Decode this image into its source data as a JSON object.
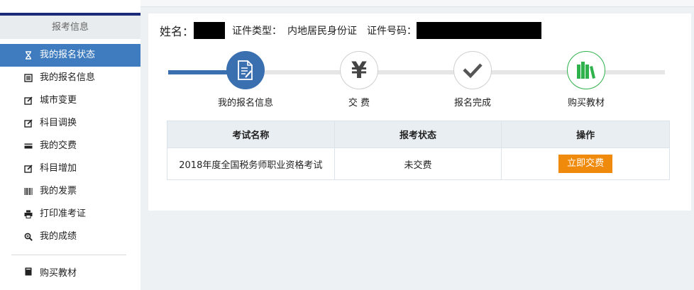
{
  "sidebar": {
    "header": "报考信息",
    "items": [
      {
        "label": "我的报名状态",
        "icon": "hourglass-icon",
        "active": true
      },
      {
        "label": "我的报名信息",
        "icon": "list-icon",
        "active": false
      },
      {
        "label": "城市变更",
        "icon": "edit-icon",
        "active": false
      },
      {
        "label": "科目调换",
        "icon": "edit-icon",
        "active": false
      },
      {
        "label": "我的交费",
        "icon": "credit-card-icon",
        "active": false
      },
      {
        "label": "科目增加",
        "icon": "edit-icon",
        "active": false
      },
      {
        "label": "我的发票",
        "icon": "barcode-icon",
        "active": false
      },
      {
        "label": "打印准考证",
        "icon": "printer-icon",
        "active": false
      },
      {
        "label": "我的成绩",
        "icon": "zoom-icon",
        "active": false
      }
    ],
    "extra": {
      "label": "购买教材",
      "icon": "book-icon"
    }
  },
  "user": {
    "name_label": "姓名：",
    "id_type_label": "证件类型：",
    "id_type_value": "内地居民身份证",
    "id_number_label": "证件号码："
  },
  "steps": [
    {
      "label": "我的报名信息",
      "icon": "document-edit-icon"
    },
    {
      "label": "交 费",
      "icon": "yen-icon",
      "glyph": "¥"
    },
    {
      "label": "报名完成",
      "icon": "checkmark-icon"
    },
    {
      "label": "购买教材",
      "icon": "books-icon"
    }
  ],
  "table": {
    "headers": [
      "考试名称",
      "报考状态",
      "操作"
    ],
    "rows": [
      {
        "name": "2018年度全国税务师职业资格考试",
        "status": "未交费",
        "action": "立即交费"
      }
    ]
  },
  "colors": {
    "active_blue": "#3f7cbf",
    "progress_blue": "#3a6fb0",
    "accent_navy": "#1b2b7a",
    "pay_orange": "#f08a0c",
    "book_green": "#2fb24c"
  }
}
